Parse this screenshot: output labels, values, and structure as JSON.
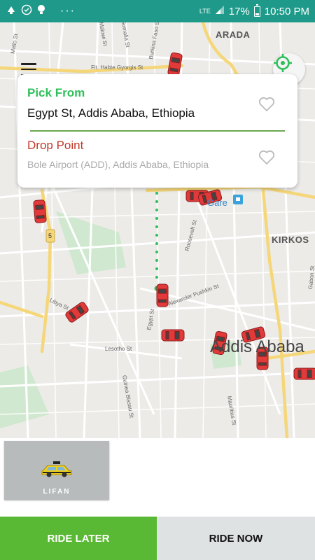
{
  "status_bar": {
    "battery_percent": "17%",
    "time": "10:50 PM",
    "network": "LTE",
    "more_dots": "···",
    "icons": [
      "notification-icon",
      "check-circle-icon",
      "lightbulb-icon",
      "signal-icon",
      "battery-icon"
    ]
  },
  "map": {
    "labels": {
      "arada": "ARADA",
      "kirkos": "KIRKOS",
      "addis_ababa": "Addis Ababa",
      "gare": "Gare",
      "route_5": "5",
      "mallo_st": "Mallo St",
      "malowi_st": "Malowi St",
      "somalia_st": "Somalia St",
      "burkina_faso_st": "Burkina Faso St",
      "habte_giyorgis": "Fit. Habte Gyorgis St",
      "libya_st": "Libya St",
      "egypt_st": "Egypt St",
      "lesotho_st": "Lesotho St",
      "guinea_bissau_st": "Guinea Bissau St",
      "roosevelt_st": "Roosevelt St",
      "pushkin_st": "Alexander Pushkin St",
      "mauritius_st": "Mauritius St",
      "gabon_st": "Gabon St"
    },
    "colors": {
      "route_dots": "#2fbf5a",
      "car": "#e23a3a",
      "road_major": "#f5d77a"
    }
  },
  "location_card": {
    "pick_label": "Pick From",
    "pick_value": "Egypt St, Addis Ababa, Ethiopia",
    "drop_label": "Drop Point",
    "drop_value": "Bole Airport (ADD), Addis Ababa, Ethiopia"
  },
  "car_types": [
    {
      "label": "LIFAN",
      "icon": "taxi-icon"
    }
  ],
  "buttons": {
    "ride_later": "RIDE LATER",
    "ride_now": "RIDE NOW"
  }
}
